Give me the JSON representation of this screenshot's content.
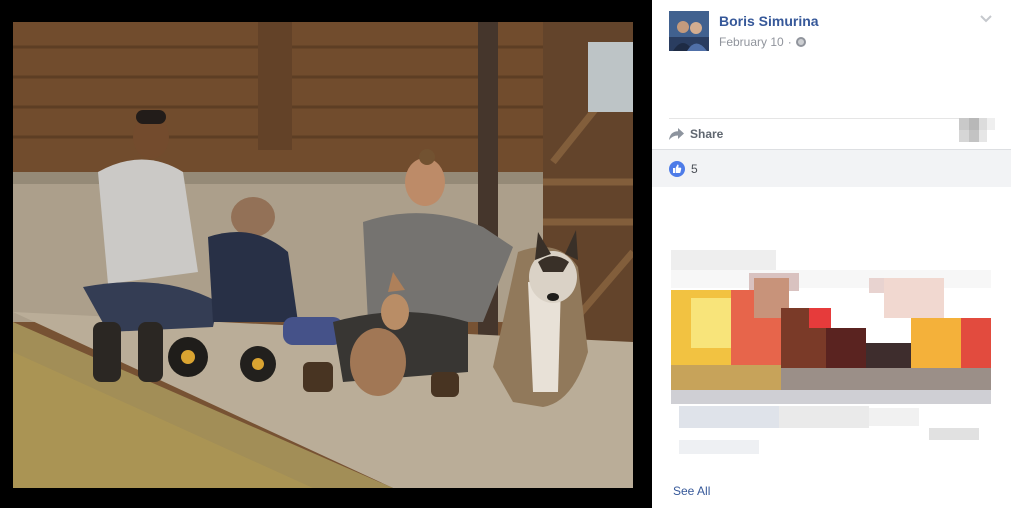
{
  "post": {
    "author": "Boris Simurina",
    "date": "February 10",
    "separator": "·",
    "privacy_icon": "globe-icon"
  },
  "actions": {
    "share_label": "Share",
    "share_icon": "share-arrow-icon"
  },
  "reactions": {
    "like_icon": "thumbs-up-icon",
    "count": "5"
  },
  "footer": {
    "see_all_label": "See All"
  },
  "colors": {
    "link": "#365899",
    "muted": "#90949c",
    "like_blue": "#4e7ce8",
    "panel_bg": "#ffffff",
    "viewer_bg": "#000000"
  }
}
